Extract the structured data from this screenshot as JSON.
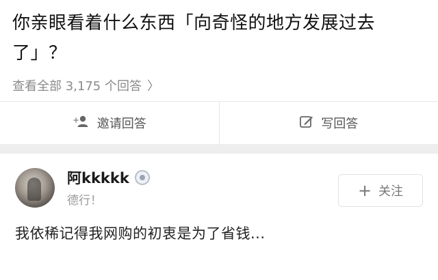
{
  "question": {
    "title": "你亲眼看着什么东西「向奇怪的地方发展过去了」？",
    "view_all_text": "查看全部 3,175 个回答",
    "view_all_chevron": "〉"
  },
  "actions": {
    "invite_label": "邀请回答",
    "invite_icon": "add-user-icon",
    "write_label": "写回答",
    "write_icon": "edit-icon"
  },
  "answer": {
    "author_name": "阿kkkkk",
    "author_bio": "德行！",
    "badge_icon": "verified-badge-icon",
    "follow_plus": "+",
    "follow_label": "关注",
    "excerpt": "我依稀记得我网购的初衷是为了省钱..."
  },
  "colors": {
    "background": "#f2f2f2",
    "card": "#ffffff",
    "muted_text": "#8a8a8a",
    "primary_text": "#1a1a1a"
  }
}
